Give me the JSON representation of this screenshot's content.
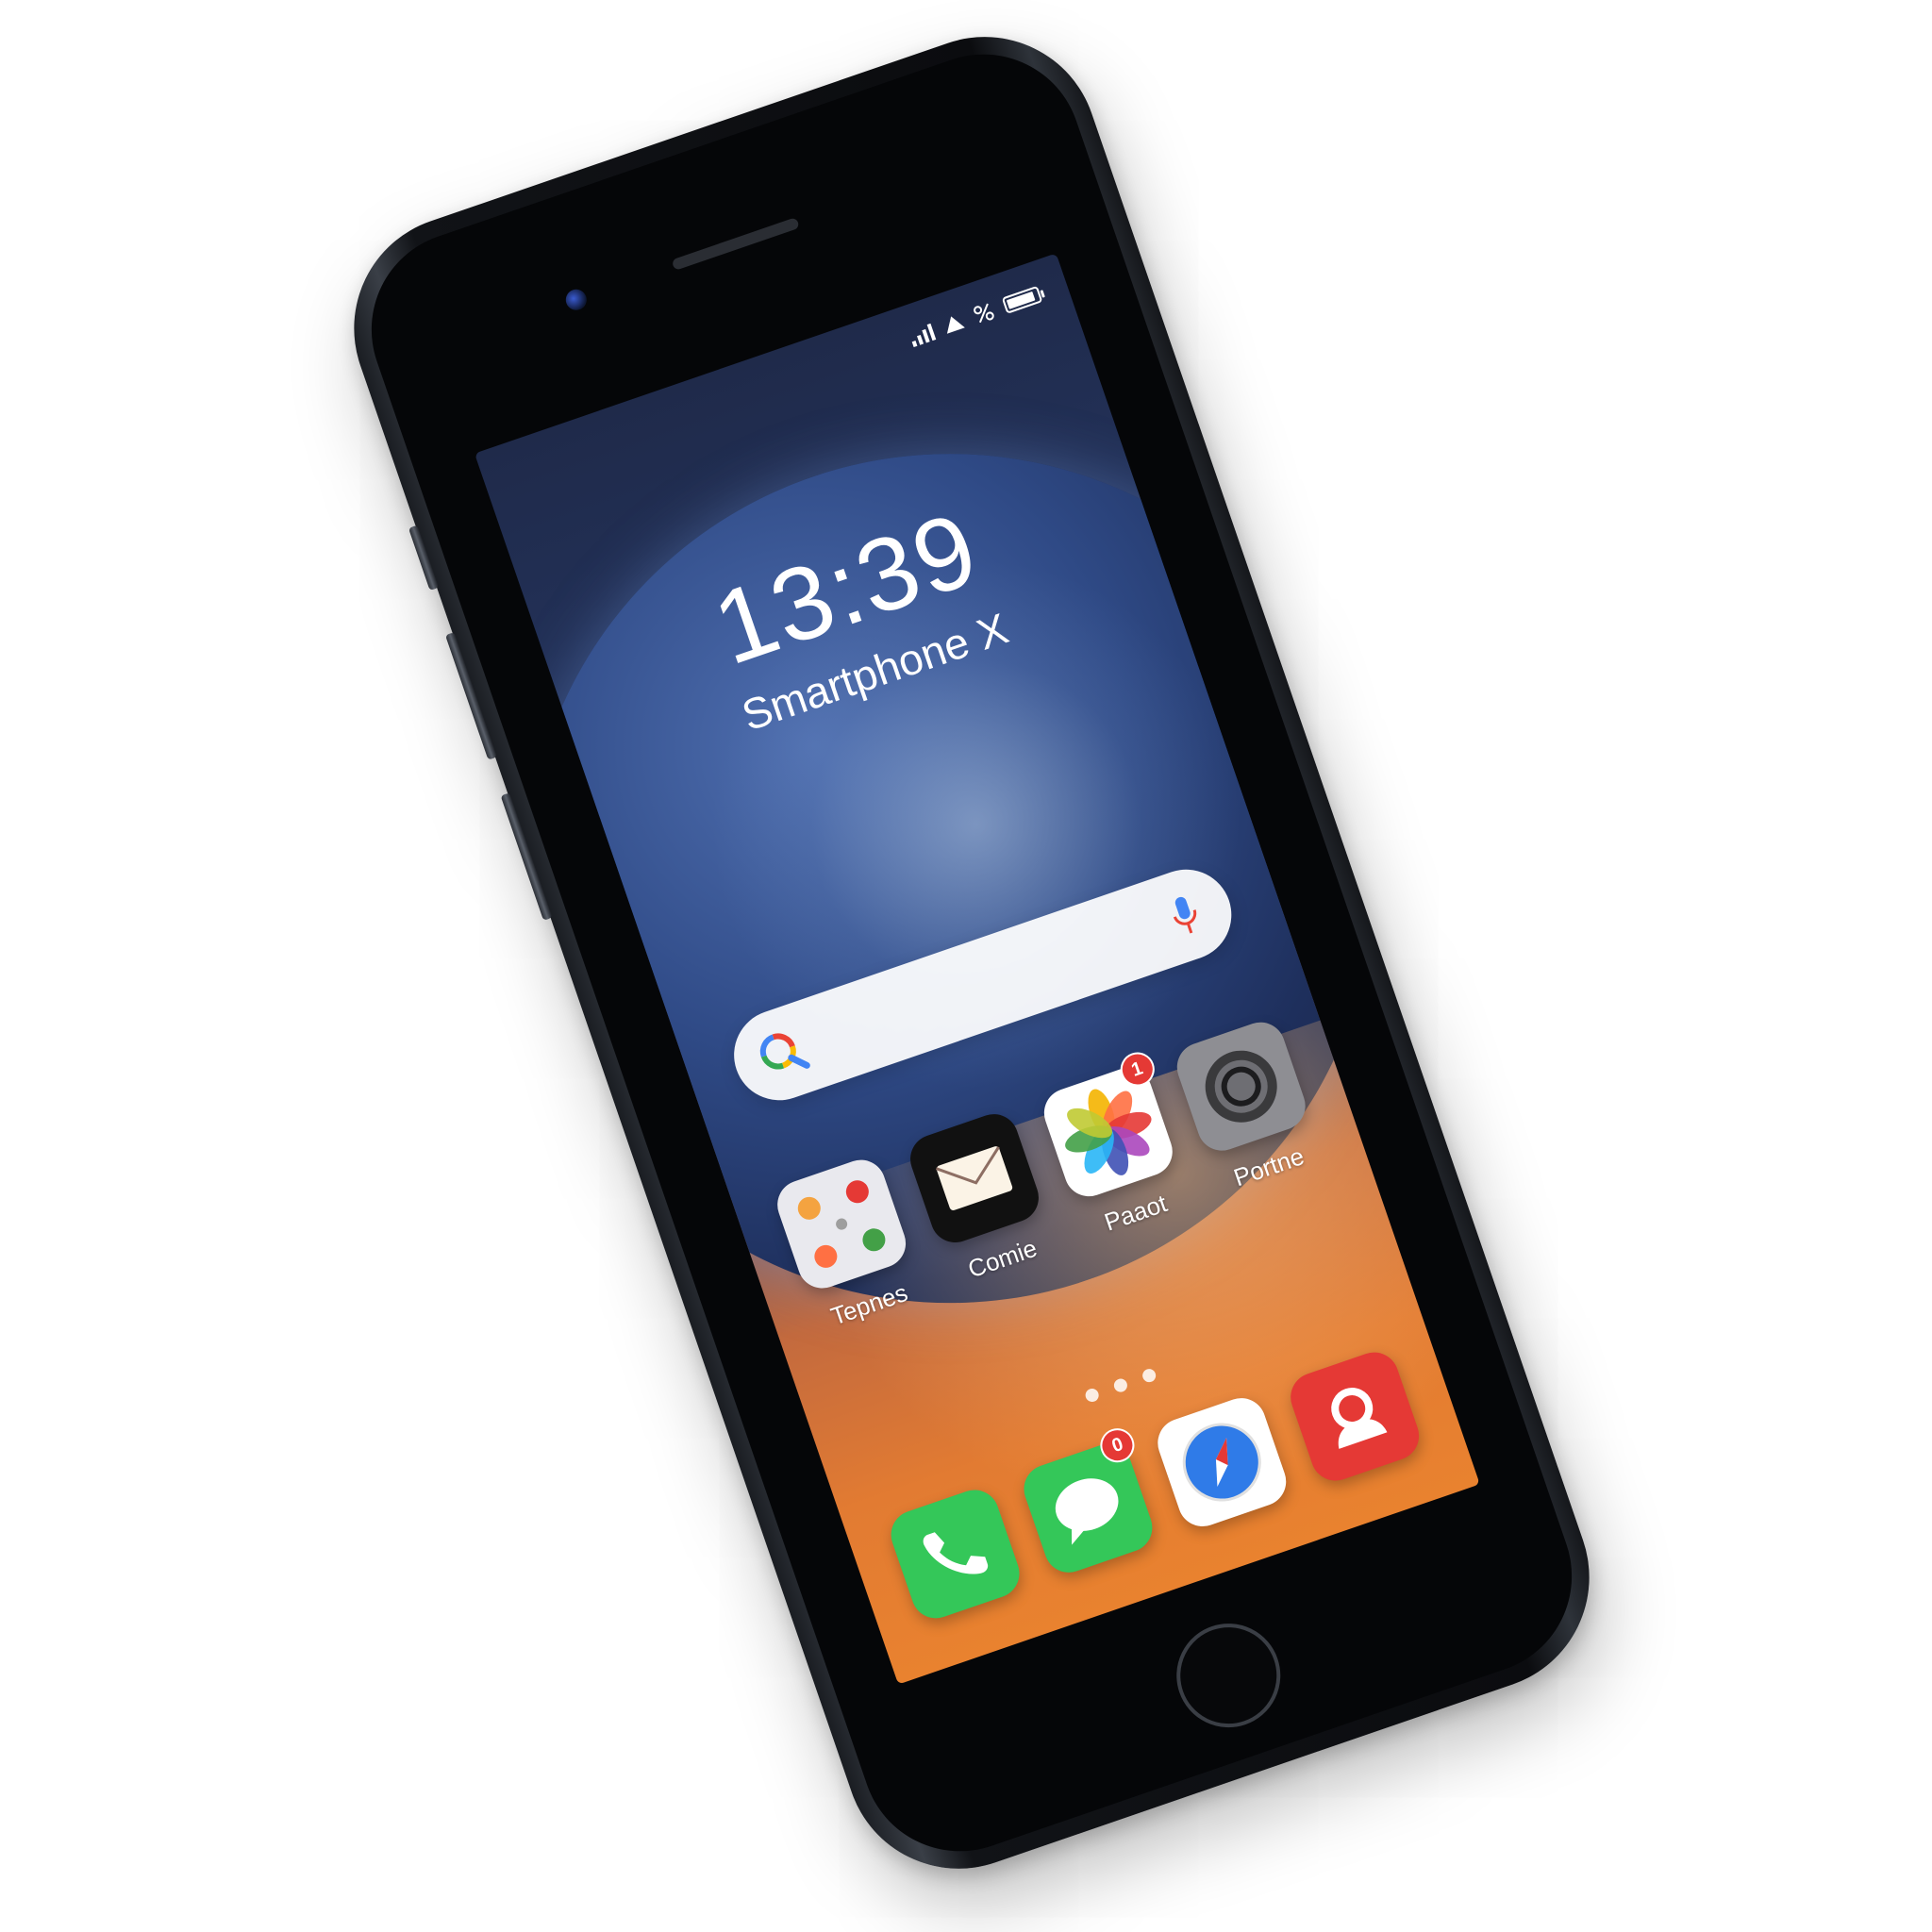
{
  "status_bar": {
    "battery_level": 0.9,
    "signal_icon": "cellular-signal-icon",
    "wifi_icon": "wifi-icon",
    "data_icon": "percent-data-icon",
    "battery_icon": "battery-icon"
  },
  "lock": {
    "time": "13:39",
    "device_name": "Smartphone X"
  },
  "search": {
    "search_icon": "search-icon",
    "mic_icon": "microphone-icon"
  },
  "apps": [
    {
      "label": "Tepnes",
      "icon": "folder-icon",
      "badge": ""
    },
    {
      "label": "Comie",
      "icon": "mail-icon",
      "badge": ""
    },
    {
      "label": "Paaot",
      "icon": "photos-icon",
      "badge": "1"
    },
    {
      "label": "Portne",
      "icon": "settings-icon",
      "badge": ""
    }
  ],
  "dock": [
    {
      "icon": "phone-icon",
      "badge": ""
    },
    {
      "icon": "messages-icon",
      "badge": "0"
    },
    {
      "icon": "safari-compass-icon",
      "badge": ""
    },
    {
      "icon": "contacts-icon",
      "badge": ""
    }
  ],
  "colors": {
    "dock_phone": "#34c759",
    "dock_messages": "#34c759",
    "dock_contacts": "#e53935",
    "badge": "#e53935"
  }
}
